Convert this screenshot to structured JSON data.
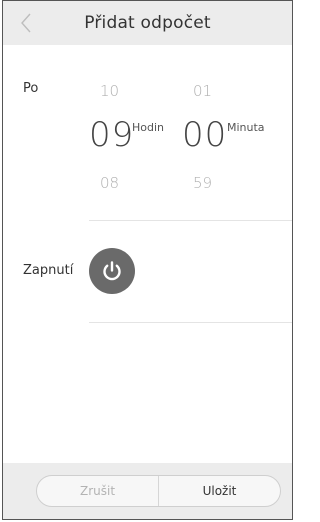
{
  "header": {
    "title": "Přidat odpočet",
    "back_icon": "chevron-left-icon"
  },
  "timer": {
    "label": "Po",
    "hours": {
      "prev": "10",
      "current": "09",
      "next": "08",
      "unit": "Hodin"
    },
    "minutes": {
      "prev": "01",
      "current": "00",
      "next": "59",
      "unit": "Minuta"
    }
  },
  "action": {
    "label": "Zapnutí",
    "icon": "power-icon",
    "state_color": "#6a6a6a"
  },
  "footer": {
    "cancel_label": "Zrušit",
    "save_label": "Uložit"
  }
}
